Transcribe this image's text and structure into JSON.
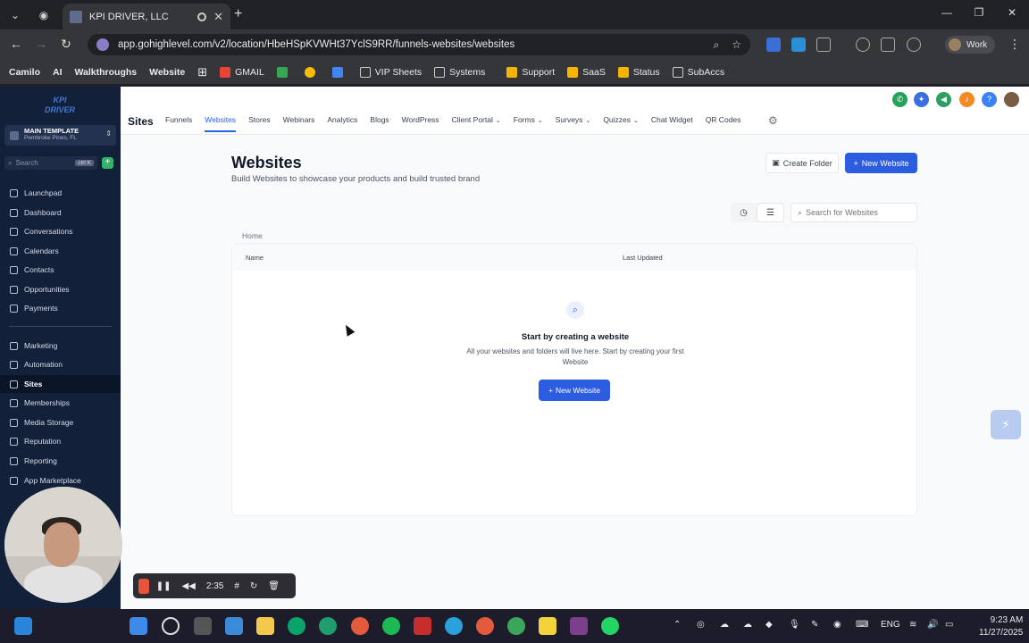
{
  "browser": {
    "tab_title": "KPI DRIVER, LLC",
    "url": "app.gohighlevel.com/v2/location/HbeHSpKVWHt37YclS9RR/funnels-websites/websites",
    "profile_label": "Work",
    "bookmarks": [
      "Camilo",
      "AI",
      "Walkthroughs",
      "Website",
      "GMAIL",
      "VIP Sheets",
      "Systems",
      "Support",
      "SaaS",
      "Status",
      "SubAccs"
    ]
  },
  "sidebar": {
    "account_name": "MAIN TEMPLATE",
    "account_location": "Pembroke Pines, FL",
    "search_placeholder": "Search",
    "search_shortcut": "ctrl K",
    "items_top": [
      "Launchpad",
      "Dashboard",
      "Conversations",
      "Calendars",
      "Contacts",
      "Opportunities",
      "Payments"
    ],
    "items_bottom": [
      "Marketing",
      "Automation",
      "Sites",
      "Memberships",
      "Media Storage",
      "Reputation",
      "Reporting",
      "App Marketplace"
    ],
    "active_item": "Sites"
  },
  "topbar": {
    "section": "Sites",
    "subnav": [
      "Funnels",
      "Websites",
      "Stores",
      "Webinars",
      "Analytics",
      "Blogs",
      "WordPress",
      "Client Portal",
      "Forms",
      "Surveys",
      "Quizzes",
      "Chat Widget",
      "QR Codes"
    ],
    "active_subnav": "Websites"
  },
  "page": {
    "title": "Websites",
    "subtitle": "Build Websites to showcase your products and build trusted brand",
    "create_folder": "Create Folder",
    "new_website": "New Website",
    "search_placeholder": "Search for Websites",
    "breadcrumb": "Home",
    "col_name": "Name",
    "col_updated": "Last Updated",
    "empty_title": "Start by creating a website",
    "empty_desc": "All your websites and folders will live here. Start by creating your first Website",
    "empty_button": "New Website"
  },
  "recorder": {
    "time": "2:35"
  },
  "taskbar": {
    "language": "ENG",
    "time": "9:23 AM",
    "date": "11/27/2025"
  },
  "colors": {
    "accent": "#2c5ce0",
    "sidebar": "#13203a"
  }
}
